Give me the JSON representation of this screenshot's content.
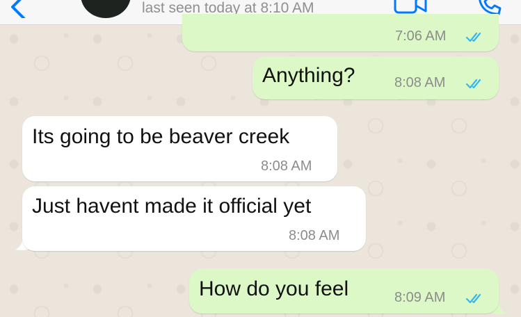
{
  "header": {
    "last_seen": "last seen today at 8:10 AM",
    "icons": [
      "back-chevron-icon",
      "video-call-icon",
      "phone-icon"
    ]
  },
  "messages": [
    {
      "direction": "outgoing",
      "text": "",
      "time": "7:06 AM",
      "status": "read"
    },
    {
      "direction": "outgoing",
      "text": "Anything?",
      "time": "8:08 AM",
      "status": "read"
    },
    {
      "direction": "incoming",
      "text": "Its going to be beaver creek",
      "time": "8:08 AM"
    },
    {
      "direction": "incoming",
      "text": "Just havent made it official yet",
      "time": "8:08 AM"
    },
    {
      "direction": "outgoing",
      "text": "How do you feel",
      "time": "8:09 AM",
      "status": "read"
    }
  ],
  "colors": {
    "outgoing_bubble": "#dcf8c6",
    "incoming_bubble": "#ffffff",
    "read_ticks": "#34b7f1",
    "ios_blue": "#007aff",
    "wallpaper": "#ebe5dc"
  }
}
